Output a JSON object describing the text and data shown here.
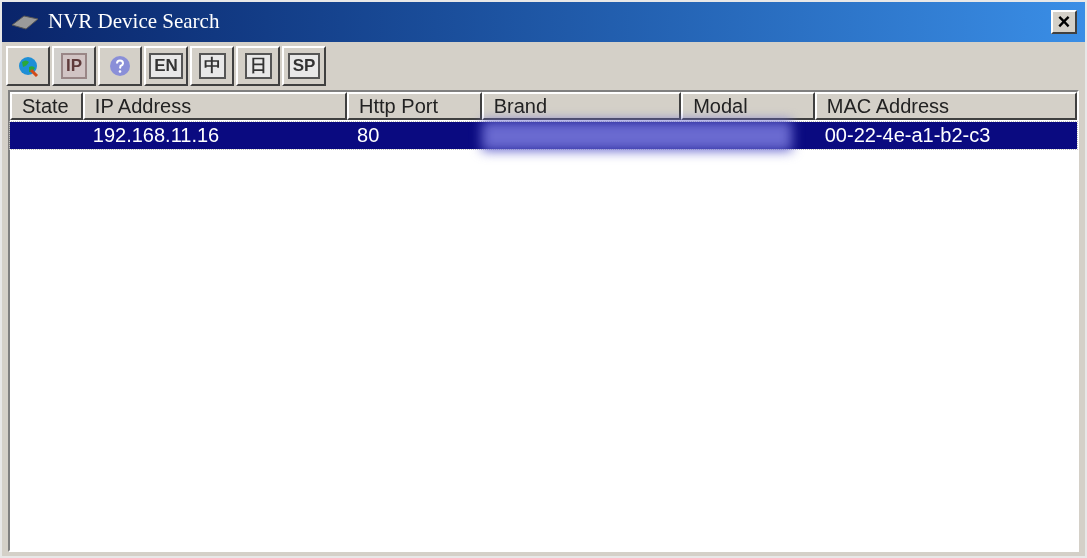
{
  "window": {
    "title": "NVR Device Search",
    "close": "×"
  },
  "toolbar": [
    {
      "kind": "search",
      "disabled": false
    },
    {
      "kind": "text",
      "label": "IP",
      "disabled": true
    },
    {
      "kind": "help",
      "disabled": false
    },
    {
      "kind": "text",
      "label": "EN",
      "disabled": false
    },
    {
      "kind": "text",
      "label": "中",
      "disabled": false
    },
    {
      "kind": "text",
      "label": "日",
      "disabled": false
    },
    {
      "kind": "text",
      "label": "SP",
      "disabled": false
    }
  ],
  "table": {
    "columns": [
      "State",
      "IP Address",
      "Http Port",
      "Brand",
      "Modal",
      "MAC Address"
    ],
    "rows": [
      {
        "ip": "192.168.11.16",
        "http_port": "80",
        "mac": "00-22-4e-a1-b2-c3",
        "selected": true
      }
    ]
  }
}
